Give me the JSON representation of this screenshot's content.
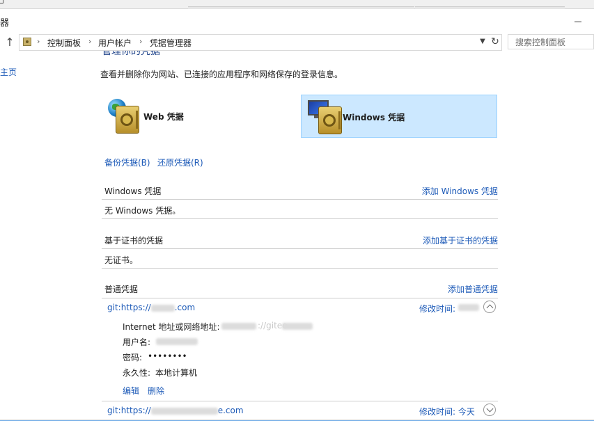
{
  "window": {
    "title": "器"
  },
  "address_bar": {
    "crumbs": [
      "控制面板",
      "用户帐户",
      "凭据管理器"
    ],
    "dropdown_icon": "chevron-down-icon",
    "refresh_icon": "refresh-icon"
  },
  "search": {
    "placeholder": "搜索控制面板"
  },
  "nav": {
    "home_label": "主页"
  },
  "main": {
    "page_title": "管理你的凭据",
    "description": "查看并删除你为网站、已连接的应用程序和网络保存的登录信息。",
    "tiles": {
      "web": {
        "label": "Web 凭据",
        "selected": false
      },
      "windows": {
        "label": "Windows 凭据",
        "selected": true
      }
    },
    "backup_label": "备份凭据(B)",
    "restore_label": "还原凭据(R)",
    "sections": {
      "windows": {
        "title": "Windows 凭据",
        "add_label": "添加 Windows 凭据",
        "empty_text": "无 Windows 凭据。"
      },
      "certificate": {
        "title": "基于证书的凭据",
        "add_label": "添加基于证书的凭据",
        "empty_text": "无证书。"
      },
      "generic": {
        "title": "普通凭据",
        "add_label": "添加普通凭据",
        "entries": [
          {
            "url_prefix": "git:https://",
            "url_suffix": ".com",
            "modified_label": "修改时间:",
            "modified_value": "",
            "expanded": true,
            "details": {
              "address_label": "Internet 地址或网络地址:",
              "address_value": "://gitee",
              "username_label": "用户名:",
              "password_label": "密码:",
              "password_value": "••••••••",
              "persistence_label": "永久性:",
              "persistence_value": "本地计算机"
            },
            "edit_label": "编辑",
            "delete_label": "删除"
          },
          {
            "url_prefix": "git:https://",
            "url_suffix": "e.com",
            "modified_label": "修改时间:",
            "modified_value": "今天",
            "expanded": false
          }
        ]
      }
    }
  },
  "colors": {
    "link": "#1e5bb8",
    "selected_tile_bg": "#cce8ff",
    "selected_tile_border": "#99d1ff",
    "divider": "#cccccc"
  }
}
